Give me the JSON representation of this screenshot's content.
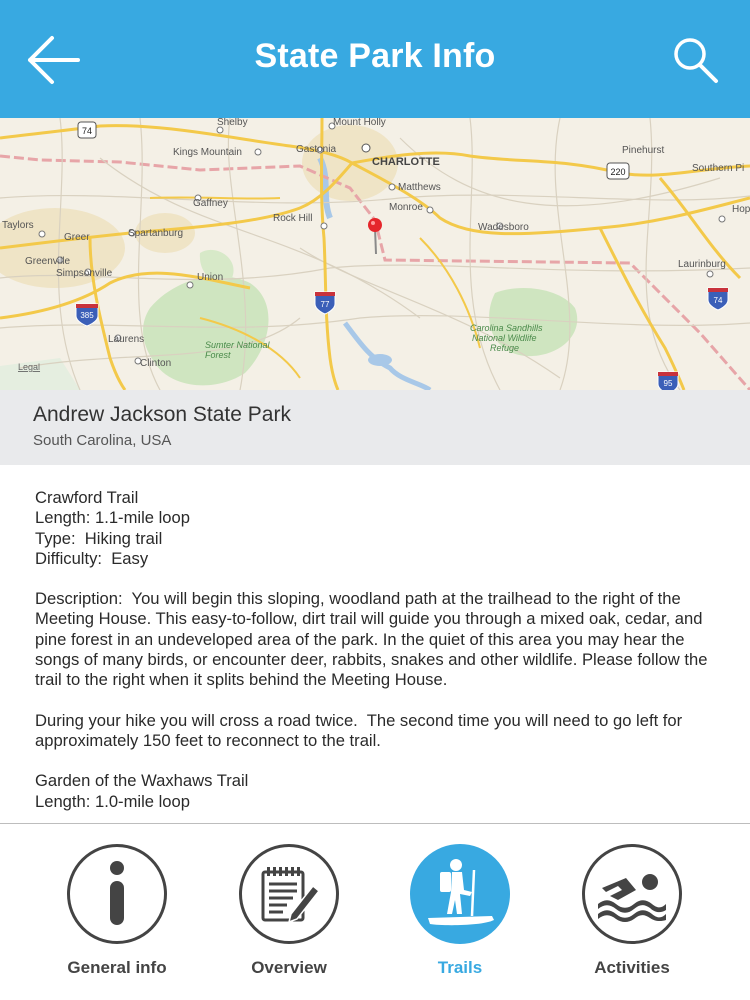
{
  "header": {
    "title": "State Park Info",
    "back_icon": "arrow-left-icon",
    "search_icon": "search-icon",
    "color": "#38a9e1"
  },
  "map": {
    "labels": {
      "shelby": "Shelby",
      "mount_holly": "Mount Holly",
      "kings_mountain": "Kings Mountain",
      "gastonia": "Gastonia",
      "charlotte": "CHARLOTTE",
      "matthews": "Matthews",
      "pinehurst": "Pinehurst",
      "southern_pines": "Southern Pi",
      "gaffney": "Gaffney",
      "monroe": "Monroe",
      "rock_hill": "Rock Hill",
      "wadesboro": "Wadesboro",
      "taylors": "Taylors",
      "greer": "Greer",
      "spartanburg": "Spartanburg",
      "greenville": "Greenville",
      "simpsonville": "Simpsonville",
      "union": "Union",
      "laurinburg": "Laurinburg",
      "hope": "Hop",
      "laurens": "Laurens",
      "clinton": "Clinton",
      "sumter_nf_1": "Sumter National",
      "sumter_nf_2": "Forest",
      "carolina_1": "Carolina Sandhills",
      "carolina_2": "National Wildlife",
      "carolina_3": "Refuge",
      "legal": "Legal"
    },
    "shields": {
      "i74_west": "74",
      "i220": "220",
      "i385": "385",
      "i77": "77",
      "i74_east": "74",
      "i95": "95"
    }
  },
  "park": {
    "name": "Andrew Jackson State Park",
    "location": "South Carolina, USA"
  },
  "content": {
    "trail1": {
      "name": "Crawford Trail",
      "length": "Length: 1.1-mile loop",
      "type": "Type:  Hiking trail",
      "difficulty": "Difficulty:  Easy"
    },
    "description": "Description:  You will begin this sloping, woodland path at the trailhead to the right of the Meeting House. This easy-to-follow, dirt trail will guide you through a mixed oak, cedar, and pine forest in an undeveloped area of the park. In the quiet of this area you may hear the songs of many birds, or encounter deer, rabbits, snakes and other wildlife. Please follow the trail to the right when it splits behind the Meeting House.",
    "hike_note": "During your hike you will cross a road twice.  The second time you will need to go left for approximately 150 feet to reconnect to the trail.",
    "trail2": {
      "name": "Garden of the Waxhaws Trail",
      "length": "Length: 1.0-mile loop"
    }
  },
  "tabs": [
    {
      "label": "General info",
      "icon": "info-icon",
      "active": false
    },
    {
      "label": "Overview",
      "icon": "notepad-pencil-icon",
      "active": false
    },
    {
      "label": "Trails",
      "icon": "hiker-icon",
      "active": true
    },
    {
      "label": "Activities",
      "icon": "swimmer-icon",
      "active": false
    }
  ]
}
